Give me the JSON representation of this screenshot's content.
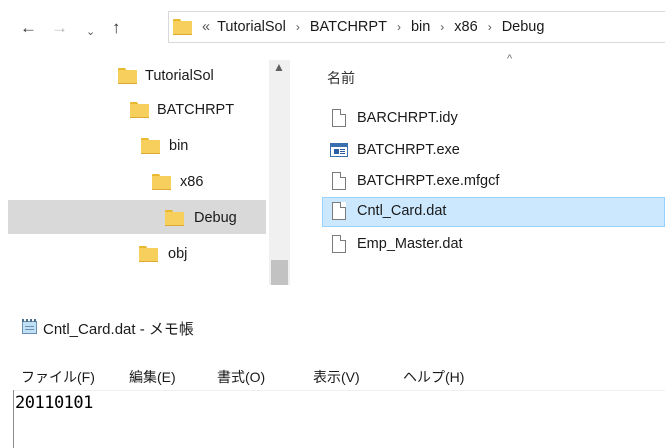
{
  "explorer": {
    "nav": {
      "back_icon": "arrow-left-icon",
      "forward_icon": "arrow-right-icon",
      "recent_icon": "chevron-down-icon",
      "up_icon": "arrow-up-icon"
    },
    "address": {
      "overflow": "«",
      "segments": [
        "TutorialSol",
        "BATCHRPT",
        "bin",
        "x86",
        "Debug"
      ],
      "separator": "›"
    },
    "tree": [
      {
        "label": "TutorialSol"
      },
      {
        "label": "BATCHRPT"
      },
      {
        "label": "bin"
      },
      {
        "label": "x86"
      },
      {
        "label": "Debug",
        "selected": true
      },
      {
        "label": "obj"
      }
    ],
    "list": {
      "column_name": "名前",
      "sort_caret": "^",
      "files": [
        {
          "name": "BARCHRPT.idy",
          "icon": "document-icon"
        },
        {
          "name": "BATCHRPT.exe",
          "icon": "application-icon"
        },
        {
          "name": "BATCHRPT.exe.mfgcf",
          "icon": "document-icon"
        },
        {
          "name": "Cntl_Card.dat",
          "icon": "document-icon",
          "selected": true
        },
        {
          "name": "Emp_Master.dat",
          "icon": "document-icon"
        }
      ]
    },
    "colors": {
      "folder": "#f6cf5c",
      "selection": "#cce8ff",
      "tree_selection": "#d9d9d9"
    }
  },
  "notepad": {
    "title": "Cntl_Card.dat - メモ帳",
    "icon": "notepad-icon",
    "menu": [
      "ファイル(F)",
      "編集(E)",
      "書式(O)",
      "表示(V)",
      "ヘルプ(H)"
    ],
    "content": "20110101"
  }
}
